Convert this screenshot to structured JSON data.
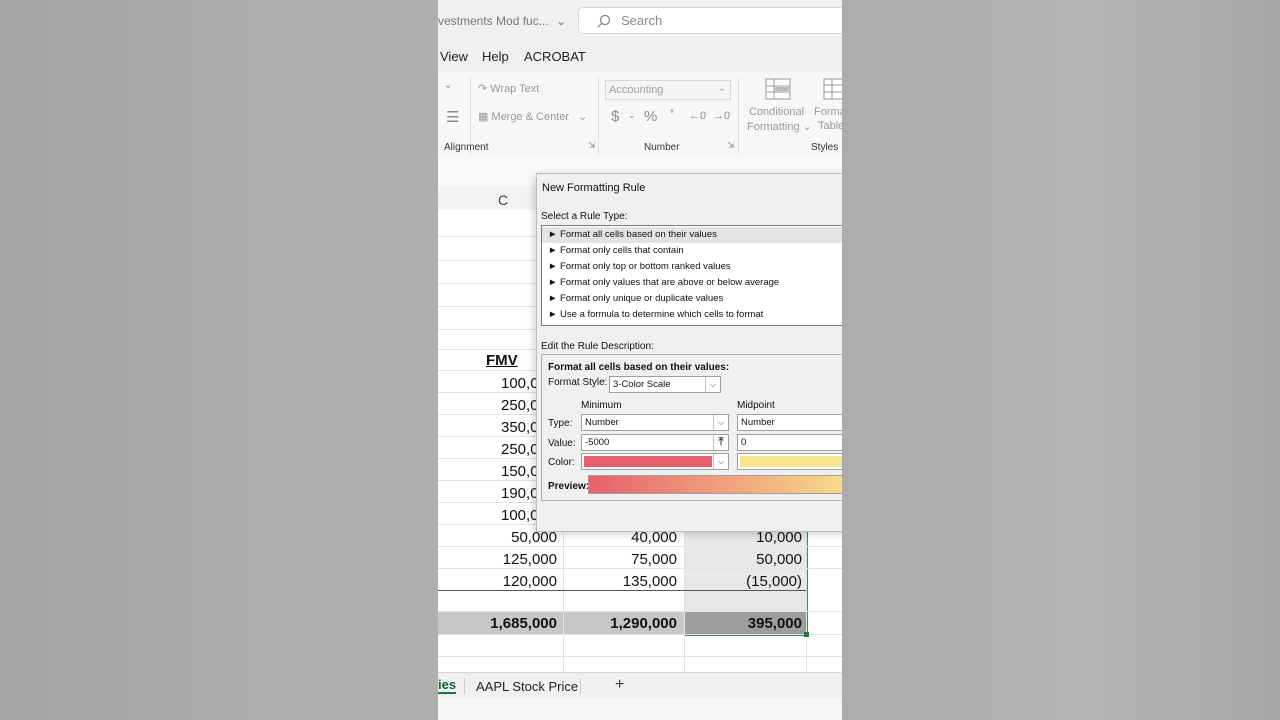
{
  "titlebar": {
    "doc_title": "vestments Mod fuc...",
    "search_placeholder": "Search"
  },
  "menu": [
    "View",
    "Help",
    "ACROBAT"
  ],
  "ribbon": {
    "wrap_text": "Wrap Text",
    "merge_center": "Merge & Center",
    "alignment_label": "Alignment",
    "number_format": "Accounting",
    "currency": "$",
    "percent": "%",
    "comma": "’",
    "number_label": "Number",
    "cond_fmt_line1": "Conditional",
    "cond_fmt_line2": "Formatting",
    "format_table_line1": "Forma",
    "format_table_line2": "Table",
    "styles_label": "Styles"
  },
  "sheet": {
    "column_header": "C",
    "header": "FMV",
    "col_c": [
      "100,0",
      "250,0",
      "350,0",
      "250,0",
      "150,0",
      "190,0",
      "100,0",
      "50,000",
      "125,000",
      "120,000"
    ],
    "col_d": [
      "40,000",
      "75,000",
      "135,000"
    ],
    "col_e": [
      "10,000",
      "50,000",
      "(15,000)"
    ],
    "totals": [
      "1,685,000",
      "1,290,000",
      "395,000"
    ]
  },
  "tabs": {
    "partial": "ies",
    "aapl": "AAPL Stock Price",
    "add": "+"
  },
  "dialog": {
    "title": "New Formatting Rule",
    "select_label": "Select a Rule Type:",
    "rules": [
      "► Format all cells based on their values",
      "► Format only cells that contain",
      "► Format only top or bottom ranked values",
      "► Format only values that are above or below average",
      "► Format only unique or duplicate values",
      "► Use a formula to determine which cells to format"
    ],
    "edit_label": "Edit the Rule Description:",
    "desc_heading": "Format all cells based on their values:",
    "format_style_label": "Format Style:",
    "format_style_value": "3-Color Scale",
    "minimum_label": "Minimum",
    "midpoint_label": "Midpoint",
    "type_label": "Type:",
    "value_label": "Value:",
    "color_label": "Color:",
    "min_type": "Number",
    "min_value": "-5000",
    "mid_type": "Number",
    "mid_value": "0",
    "preview_label": "Preview:",
    "colors": {
      "minimum": "#e8606c",
      "midpoint": "#f8e58c"
    }
  }
}
